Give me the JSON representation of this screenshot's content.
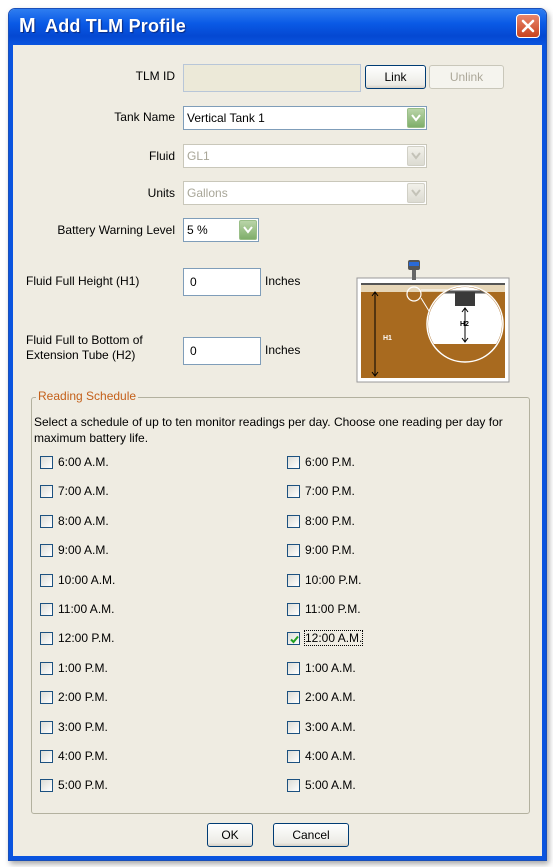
{
  "window": {
    "icon_letter": "M",
    "title": "Add TLM Profile"
  },
  "tlm_id": {
    "label": "TLM ID",
    "value": "",
    "link_label": "Link",
    "unlink_label": "Unlink"
  },
  "tank_name": {
    "label": "Tank Name",
    "value": "Vertical Tank 1"
  },
  "fluid": {
    "label": "Fluid",
    "value": "GL1"
  },
  "units": {
    "label": "Units",
    "value": "Gallons"
  },
  "battery": {
    "label": "Battery Warning Level",
    "value": "5 %"
  },
  "h1": {
    "label": "Fluid Full Height (H1)",
    "value": "0",
    "unit": "Inches"
  },
  "h2": {
    "label_line1": "Fluid Full to Bottom of",
    "label_line2": "Extension Tube (H2)",
    "value": "0",
    "unit": "Inches"
  },
  "illustration": {
    "h1_label": "H1",
    "h2_label": "H2"
  },
  "schedule": {
    "legend": "Reading Schedule",
    "description": "Select a schedule of up to ten monitor readings per day. Choose one reading per day for maximum battery life.",
    "left": [
      {
        "label": "6:00 A.M.",
        "checked": false
      },
      {
        "label": "7:00 A.M.",
        "checked": false
      },
      {
        "label": "8:00 A.M.",
        "checked": false
      },
      {
        "label": "9:00 A.M.",
        "checked": false
      },
      {
        "label": "10:00 A.M.",
        "checked": false
      },
      {
        "label": "11:00 A.M.",
        "checked": false
      },
      {
        "label": "12:00 P.M.",
        "checked": false
      },
      {
        "label": "1:00 P.M.",
        "checked": false
      },
      {
        "label": "2:00 P.M.",
        "checked": false
      },
      {
        "label": "3:00 P.M.",
        "checked": false
      },
      {
        "label": "4:00 P.M.",
        "checked": false
      },
      {
        "label": "5:00 P.M.",
        "checked": false
      }
    ],
    "right": [
      {
        "label": "6:00 P.M.",
        "checked": false
      },
      {
        "label": "7:00 P.M.",
        "checked": false
      },
      {
        "label": "8:00 P.M.",
        "checked": false
      },
      {
        "label": "9:00 P.M.",
        "checked": false
      },
      {
        "label": "10:00 P.M.",
        "checked": false
      },
      {
        "label": "11:00 P.M.",
        "checked": false
      },
      {
        "label": "12:00 A.M.",
        "checked": true
      },
      {
        "label": "1:00 A.M.",
        "checked": false
      },
      {
        "label": "2:00 A.M.",
        "checked": false
      },
      {
        "label": "3:00 A.M.",
        "checked": false
      },
      {
        "label": "4:00 A.M.",
        "checked": false
      },
      {
        "label": "5:00 A.M.",
        "checked": false
      }
    ]
  },
  "footer": {
    "ok_label": "OK",
    "cancel_label": "Cancel"
  },
  "colors": {
    "titlebar": "#0a54df",
    "legend": "#c4601a",
    "dialog_bg": "#efece2"
  }
}
